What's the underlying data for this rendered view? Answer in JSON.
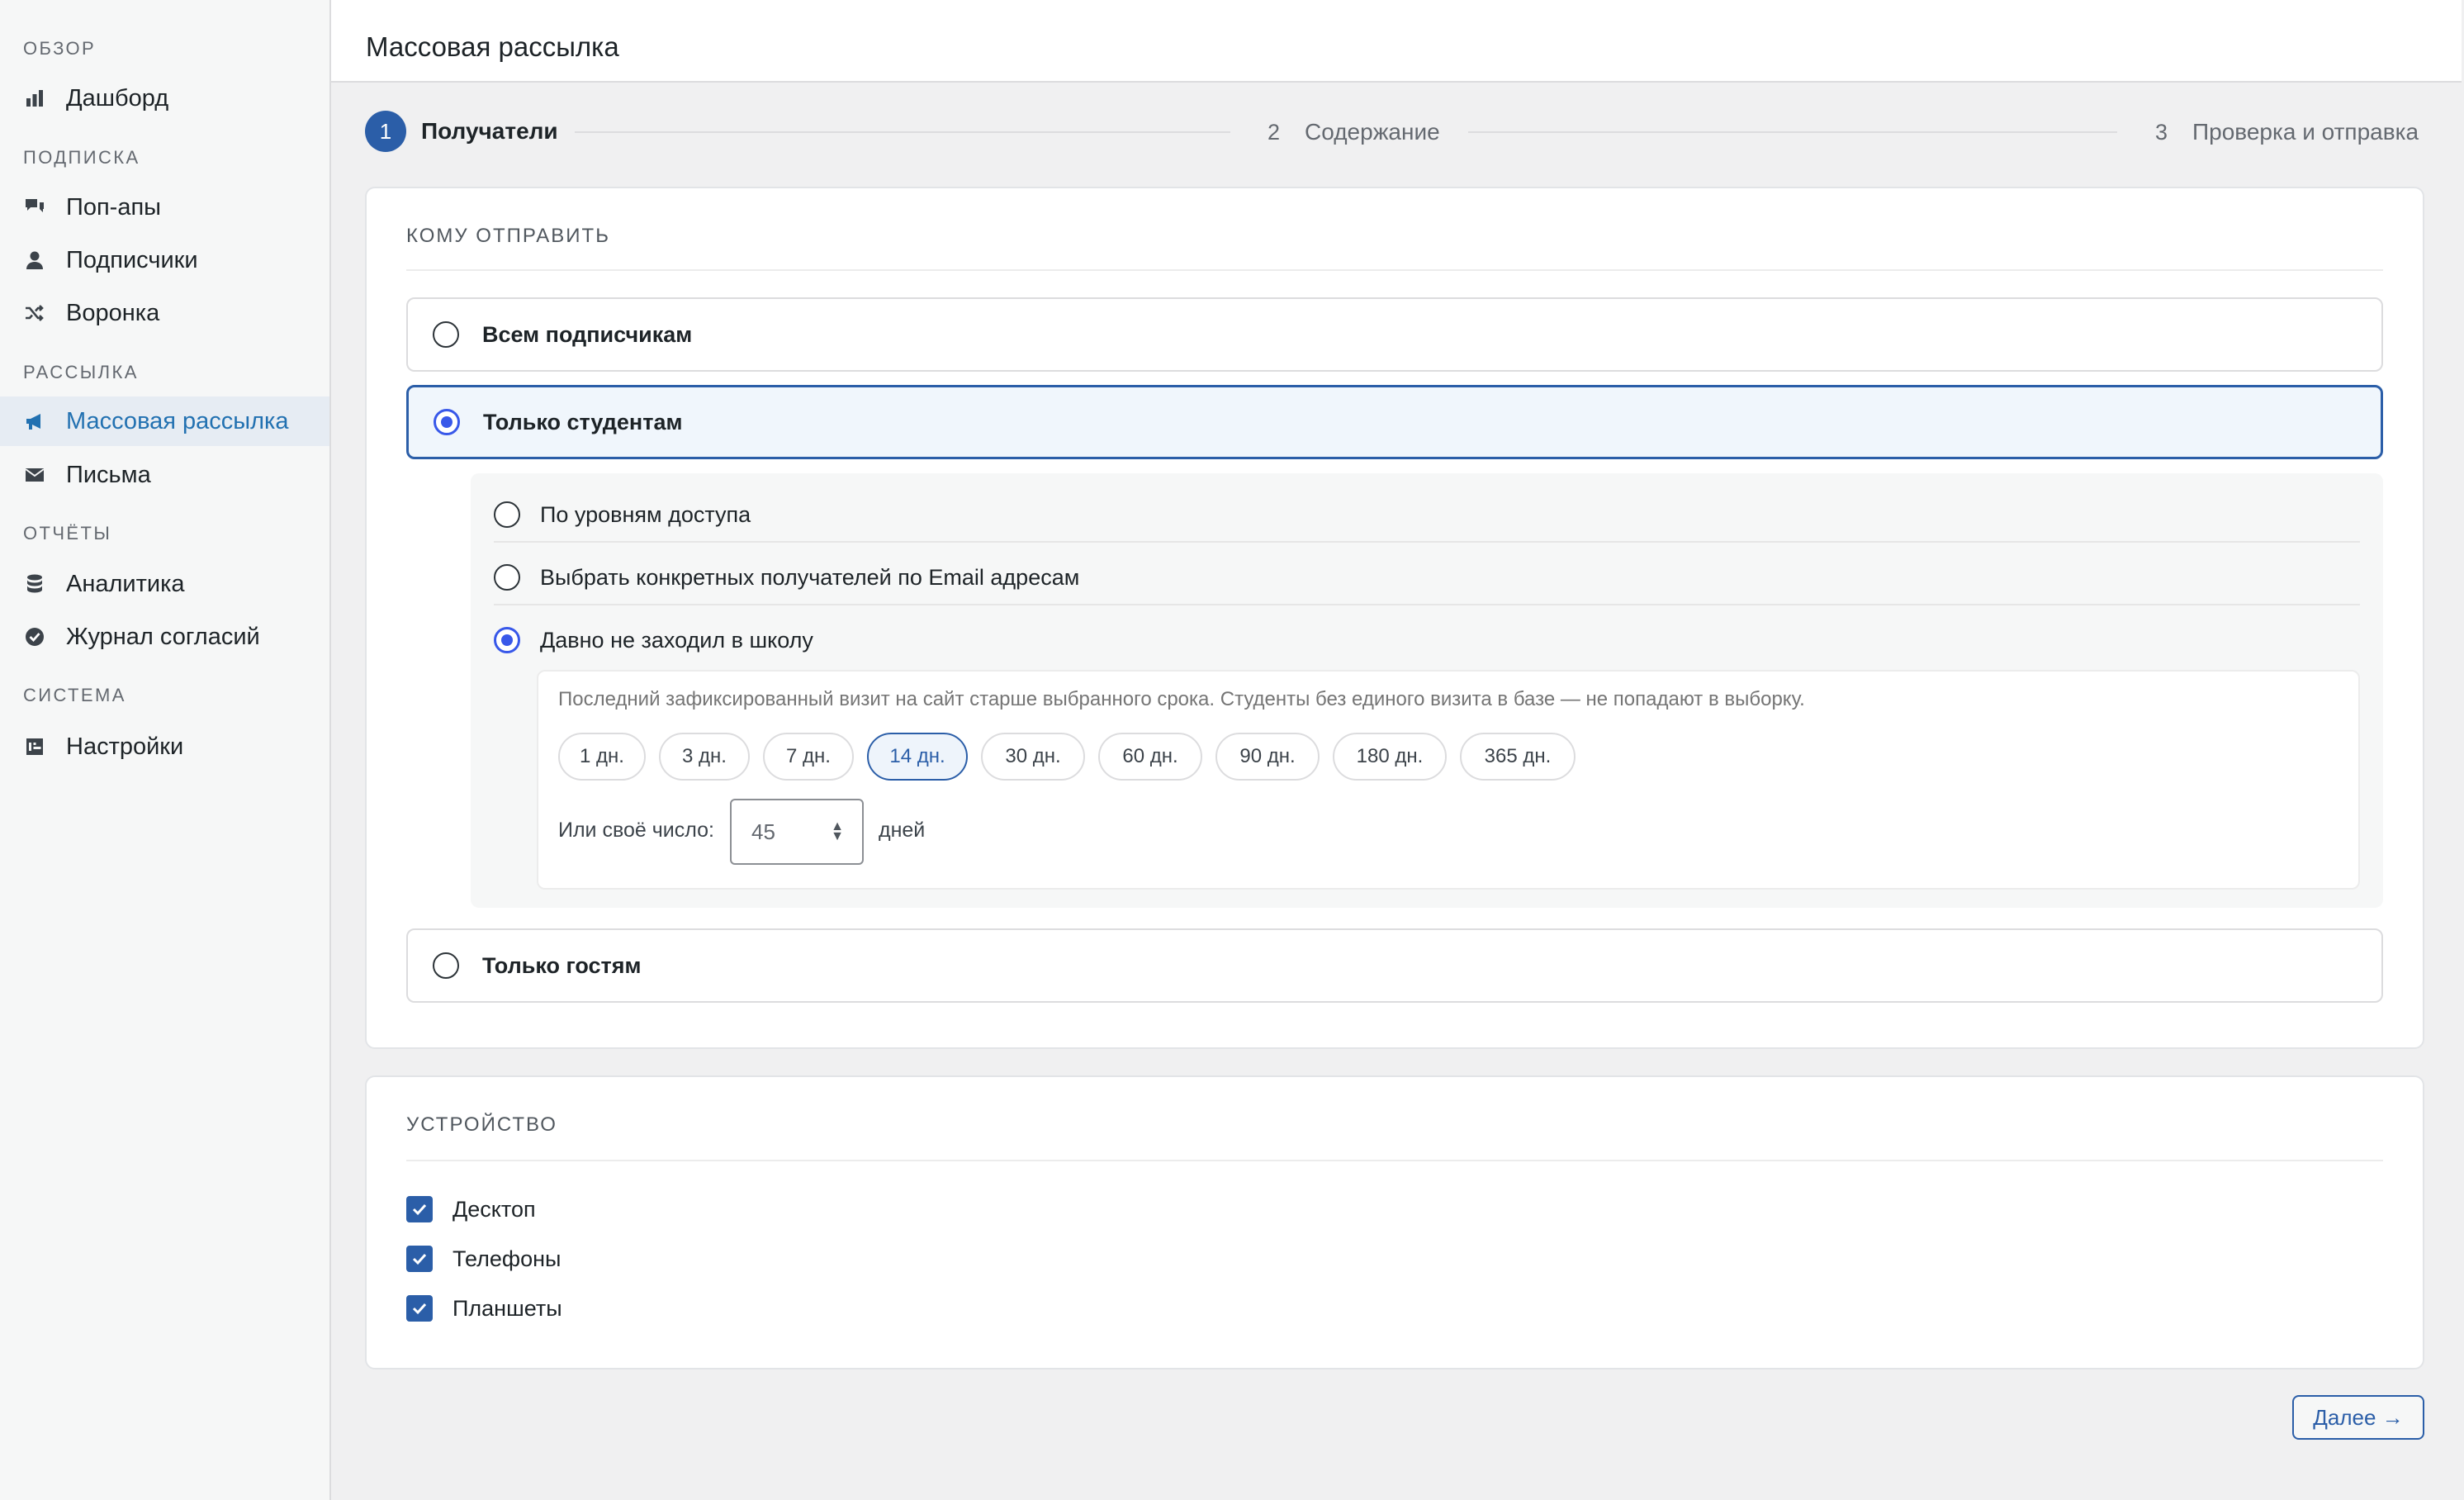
{
  "app": {
    "title": "Массовая рассылка"
  },
  "sidebar": {
    "sections": [
      {
        "label": "ОБЗОР"
      },
      {
        "label": "ПОДПИСКА"
      },
      {
        "label": "РАССЫЛКА"
      },
      {
        "label": "ОТЧЁТЫ"
      },
      {
        "label": "СИСТЕМА"
      }
    ],
    "items": [
      {
        "label": "Дашборд",
        "icon": "bar-chart-icon"
      },
      {
        "label": "Поп-апы",
        "icon": "chat-bubbles-icon"
      },
      {
        "label": "Подписчики",
        "icon": "user-icon"
      },
      {
        "label": "Воронка",
        "icon": "shuffle-icon"
      },
      {
        "label": "Массовая рассылка",
        "icon": "megaphone-icon",
        "active": true
      },
      {
        "label": "Письма",
        "icon": "envelope-icon"
      },
      {
        "label": "Аналитика",
        "icon": "database-icon"
      },
      {
        "label": "Журнал согласий",
        "icon": "check-circle-icon"
      },
      {
        "label": "Настройки",
        "icon": "settings-grid-icon"
      }
    ]
  },
  "stepper": {
    "steps": [
      {
        "num": "1",
        "label": "Получатели",
        "active": true
      },
      {
        "num": "2",
        "label": "Содержание"
      },
      {
        "num": "3",
        "label": "Проверка и отправка"
      }
    ]
  },
  "recipients": {
    "title": "КОМУ ОТПРАВИТЬ",
    "options": [
      {
        "label": "Всем подписчикам",
        "selected": false
      },
      {
        "label": "Только студентам",
        "selected": true
      },
      {
        "label": "Только гостям",
        "selected": false
      }
    ],
    "student_options": [
      {
        "label": "По уровням доступа",
        "selected": false
      },
      {
        "label": "Выбрать конкретных получателей по Email адресам",
        "selected": false
      },
      {
        "label": "Давно не заходил в школу",
        "selected": true
      }
    ],
    "inactive": {
      "hint": "Последний зафиксированный визит на сайт старше выбранного срока. Студенты без единого визита в базе — не попадают в выборку.",
      "periods": [
        "1 дн.",
        "3 дн.",
        "7 дн.",
        "14 дн.",
        "30 дн.",
        "60 дн.",
        "90 дн.",
        "180 дн.",
        "365 дн."
      ],
      "selected_period": "14 дн.",
      "custom_label": "Или своё число:",
      "custom_value": "45",
      "unit": "дней"
    }
  },
  "device": {
    "title": "УСТРОЙСТВО",
    "options": [
      {
        "label": "Десктоп",
        "checked": true
      },
      {
        "label": "Телефоны",
        "checked": true
      },
      {
        "label": "Планшеты",
        "checked": true
      }
    ]
  },
  "footer": {
    "next_label": "Далее →"
  },
  "colors": {
    "accent": "#2b5ea8",
    "radio": "#3858e9",
    "sidebar_active_bg": "#e6ecf3"
  }
}
